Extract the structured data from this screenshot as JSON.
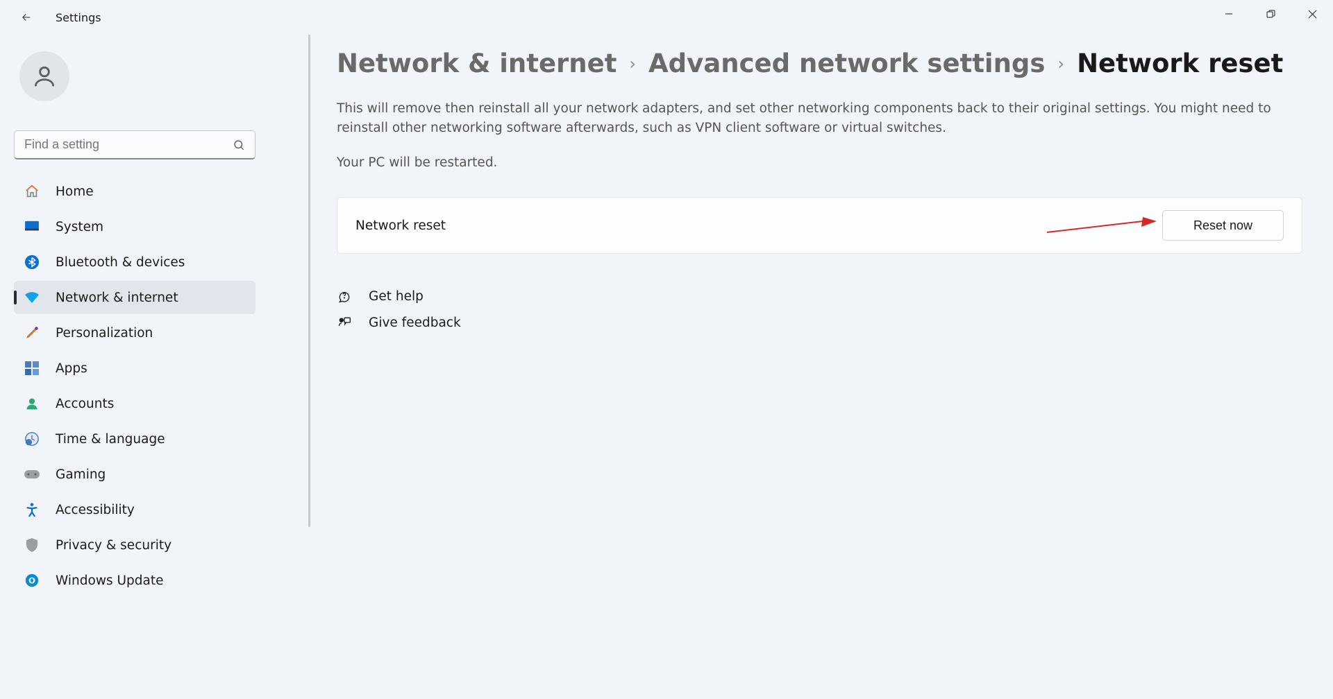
{
  "app": {
    "title": "Settings"
  },
  "search": {
    "placeholder": "Find a setting"
  },
  "sidebar": {
    "items": [
      {
        "label": "Home"
      },
      {
        "label": "System"
      },
      {
        "label": "Bluetooth & devices"
      },
      {
        "label": "Network & internet"
      },
      {
        "label": "Personalization"
      },
      {
        "label": "Apps"
      },
      {
        "label": "Accounts"
      },
      {
        "label": "Time & language"
      },
      {
        "label": "Gaming"
      },
      {
        "label": "Accessibility"
      },
      {
        "label": "Privacy & security"
      },
      {
        "label": "Windows Update"
      }
    ]
  },
  "breadcrumb": {
    "level1": "Network & internet",
    "level2": "Advanced network settings",
    "level3": "Network reset"
  },
  "page": {
    "description": "This will remove then reinstall all your network adapters, and set other networking components back to their original settings. You might need to reinstall other networking software afterwards, such as VPN client software or virtual switches.",
    "restart_note": "Your PC will be restarted."
  },
  "card": {
    "title": "Network reset",
    "button": "Reset now"
  },
  "help": {
    "get_help": "Get help",
    "feedback": "Give feedback"
  }
}
